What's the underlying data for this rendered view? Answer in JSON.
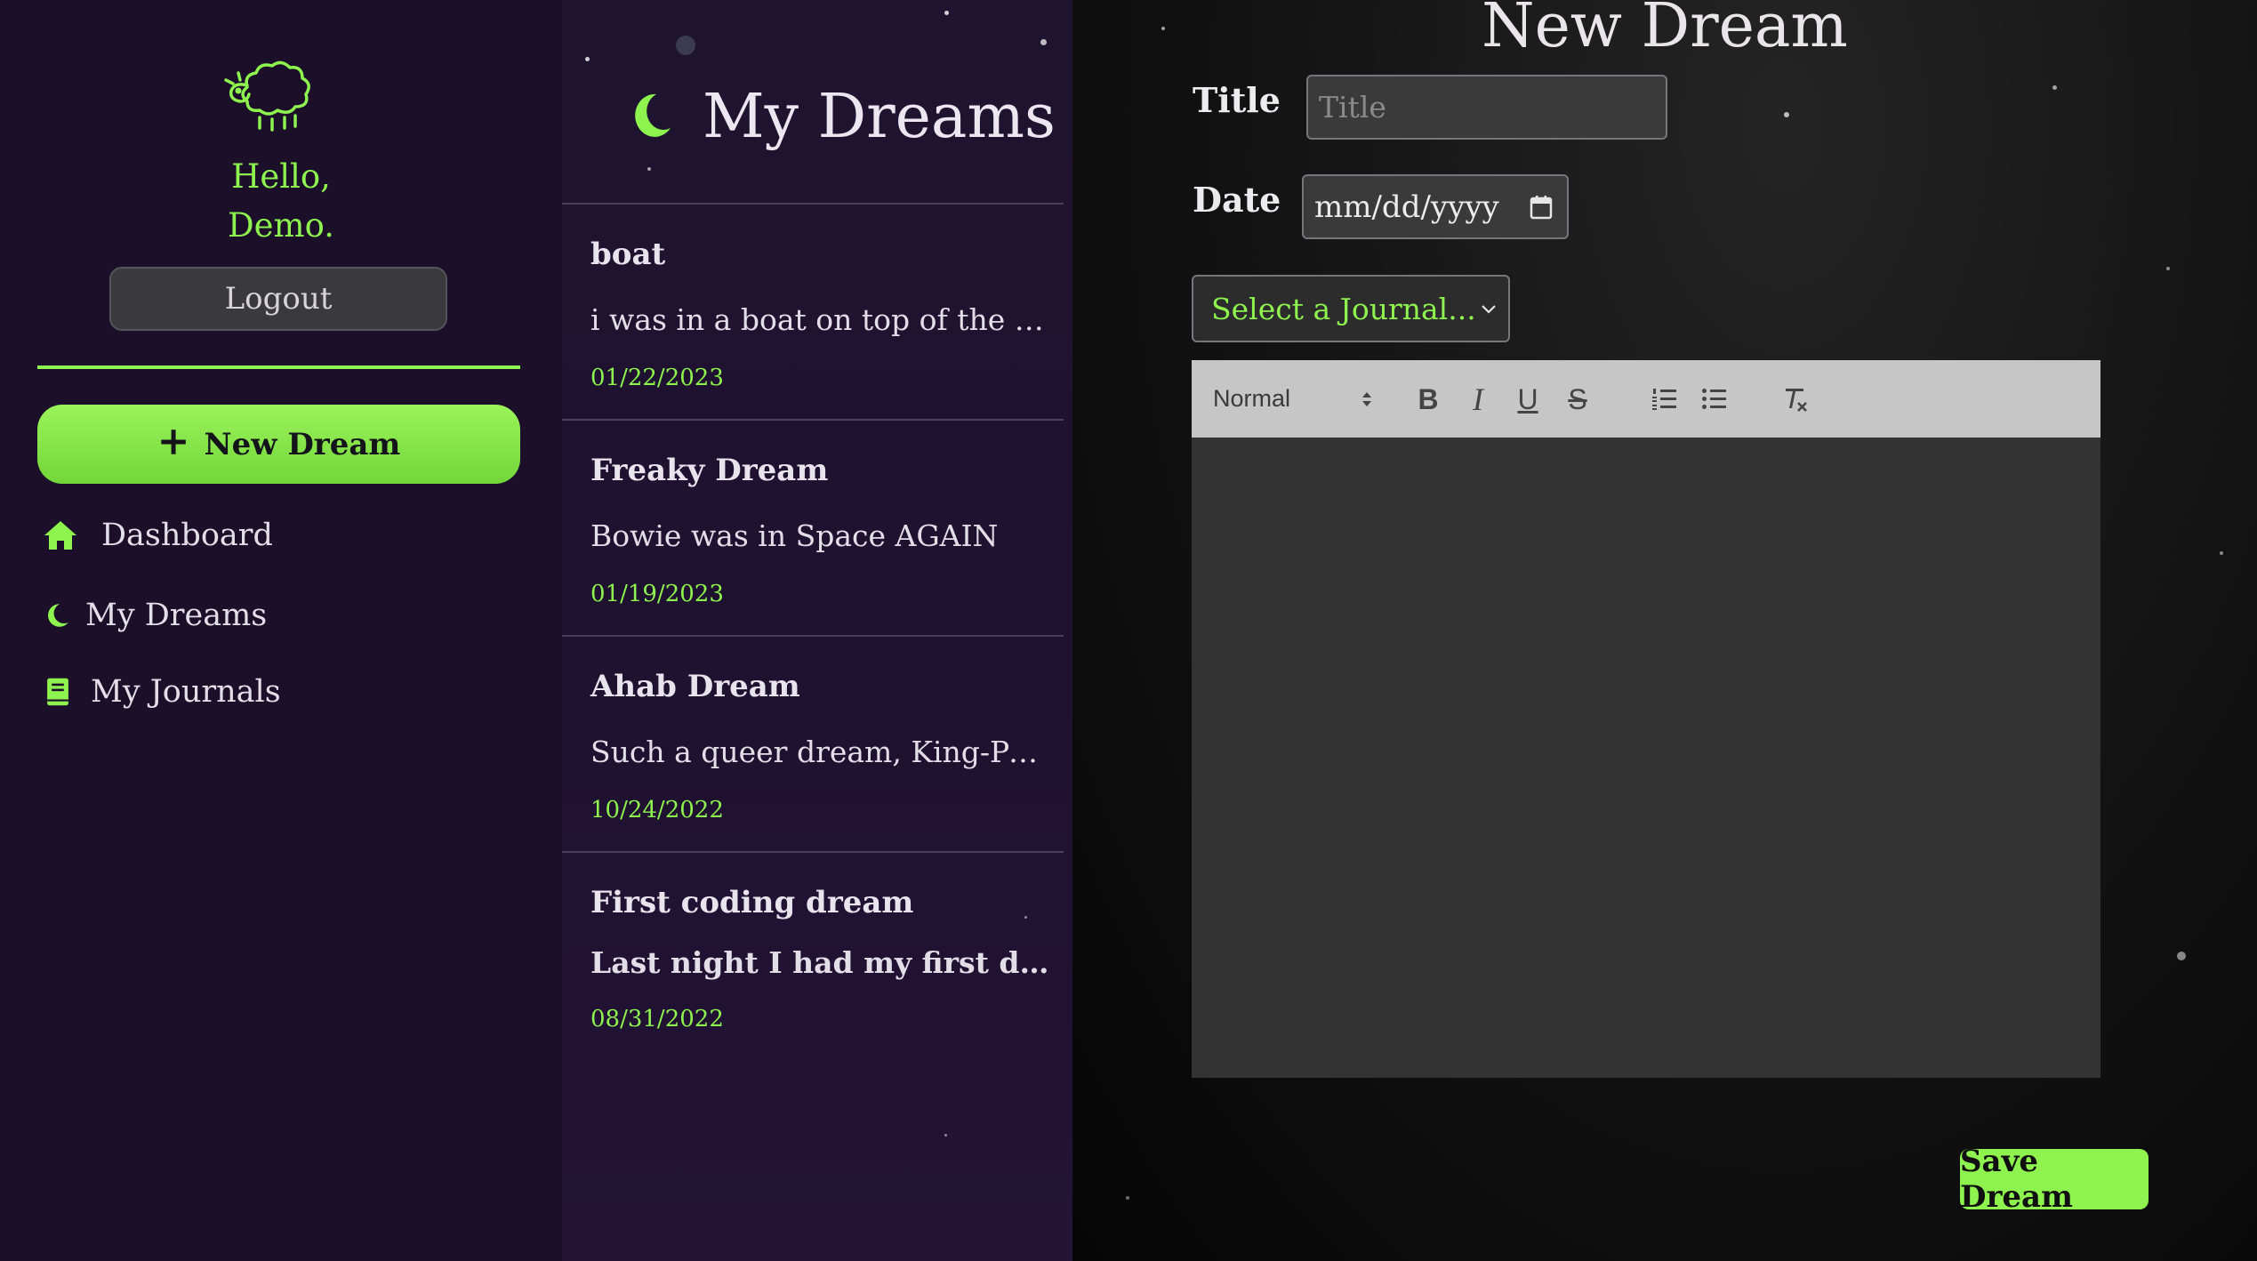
{
  "sidebar": {
    "greeting_line1": "Hello,",
    "greeting_line2": "Demo.",
    "logout_label": "Logout",
    "new_dream_label": "New Dream",
    "nav": [
      {
        "label": "Dashboard",
        "icon": "home-icon"
      },
      {
        "label": "My Dreams",
        "icon": "moon-icon"
      },
      {
        "label": "My Journals",
        "icon": "journal-book-icon"
      }
    ]
  },
  "list": {
    "title": "My Dreams",
    "dreams": [
      {
        "title": "boat",
        "snippet": "i was in a boat on top of the gian...",
        "date": "01/22/2023"
      },
      {
        "title": "Freaky Dream",
        "snippet": "Bowie was in Space AGAIN",
        "date": "01/19/2023"
      },
      {
        "title": "Ahab Dream",
        "snippet": "Such a queer dream, King-Post, ...",
        "date": "10/24/2022"
      },
      {
        "title": "First coding dream",
        "snippet": "Last night I had my first drea...",
        "date": "08/31/2022"
      }
    ]
  },
  "form": {
    "heading": "New Dream",
    "title_label": "Title",
    "title_placeholder": "Title",
    "date_label": "Date",
    "date_placeholder": "mm/dd/yyyy",
    "journal_select": "Select a Journal...",
    "toolbar_format": "Normal",
    "save_label": "Save Dream"
  },
  "colors": {
    "accent": "#8ef34e",
    "sidebar_bg": "#1b0f2a",
    "list_bg": "#1f1430",
    "editor_bg": "#333333"
  }
}
